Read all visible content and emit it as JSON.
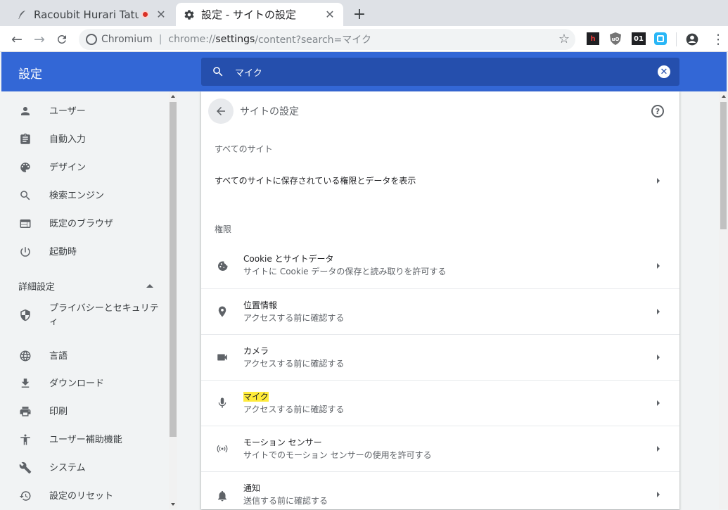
{
  "browser": {
    "tabs": [
      {
        "title": "Racoubit Hurari Tatuy",
        "active": false,
        "favicon": "feather-icon",
        "recording": true
      },
      {
        "title": "設定 - サイトの設定",
        "active": true,
        "favicon": "gear-icon"
      }
    ],
    "omnibox": {
      "origin_label": "Chromium",
      "url_scheme": "chrome://",
      "url_host": "settings",
      "url_rest": "/content?search=マイク"
    },
    "extensions": [
      {
        "name": "h-extension",
        "color": "#c62828",
        "text": "h"
      },
      {
        "name": "ublock-origin",
        "color": "#5f6368",
        "text": "uO"
      },
      {
        "name": "01-extension",
        "color": "#202124",
        "text": "01"
      },
      {
        "name": "teal-extension",
        "color": "#29b6f6",
        "text": ""
      }
    ]
  },
  "settings": {
    "header_title": "設定",
    "search": {
      "query": "マイク"
    },
    "sidebar": {
      "items": [
        {
          "label": "ユーザー",
          "icon": "person-icon"
        },
        {
          "label": "自動入力",
          "icon": "clipboard-icon"
        },
        {
          "label": "デザイン",
          "icon": "palette-icon"
        },
        {
          "label": "検索エンジン",
          "icon": "search-icon"
        },
        {
          "label": "既定のブラウザ",
          "icon": "browser-icon"
        },
        {
          "label": "起動時",
          "icon": "power-icon"
        }
      ],
      "advanced_label": "詳細設定",
      "advanced_items": [
        {
          "label": "プライバシーとセキュリティ",
          "icon": "shield-icon"
        },
        {
          "label": "言語",
          "icon": "globe-icon"
        },
        {
          "label": "ダウンロード",
          "icon": "download-icon"
        },
        {
          "label": "印刷",
          "icon": "printer-icon"
        },
        {
          "label": "ユーザー補助機能",
          "icon": "accessibility-icon"
        },
        {
          "label": "システム",
          "icon": "wrench-icon"
        },
        {
          "label": "設定のリセット",
          "icon": "history-icon"
        }
      ]
    },
    "page": {
      "title": "サイトの設定",
      "all_sites_section": "すべてのサイト",
      "all_sites_row": "すべてのサイトに保存されている権限とデータを表示",
      "permissions_section": "権限",
      "permissions": [
        {
          "title": "Cookie とサイトデータ",
          "subtitle": "サイトに Cookie データの保存と読み取りを許可する",
          "icon": "cookie-icon",
          "highlight": false
        },
        {
          "title": "位置情報",
          "subtitle": "アクセスする前に確認する",
          "icon": "location-pin-icon",
          "highlight": false
        },
        {
          "title": "カメラ",
          "subtitle": "アクセスする前に確認する",
          "icon": "camera-icon",
          "highlight": false
        },
        {
          "title": "マイク",
          "subtitle": "アクセスする前に確認する",
          "icon": "microphone-icon",
          "highlight": true
        },
        {
          "title": "モーション センサー",
          "subtitle": "サイトでのモーション センサーの使用を許可する",
          "icon": "sensor-icon",
          "highlight": false
        },
        {
          "title": "通知",
          "subtitle": "送信する前に確認する",
          "icon": "bell-icon",
          "highlight": false
        }
      ]
    }
  }
}
